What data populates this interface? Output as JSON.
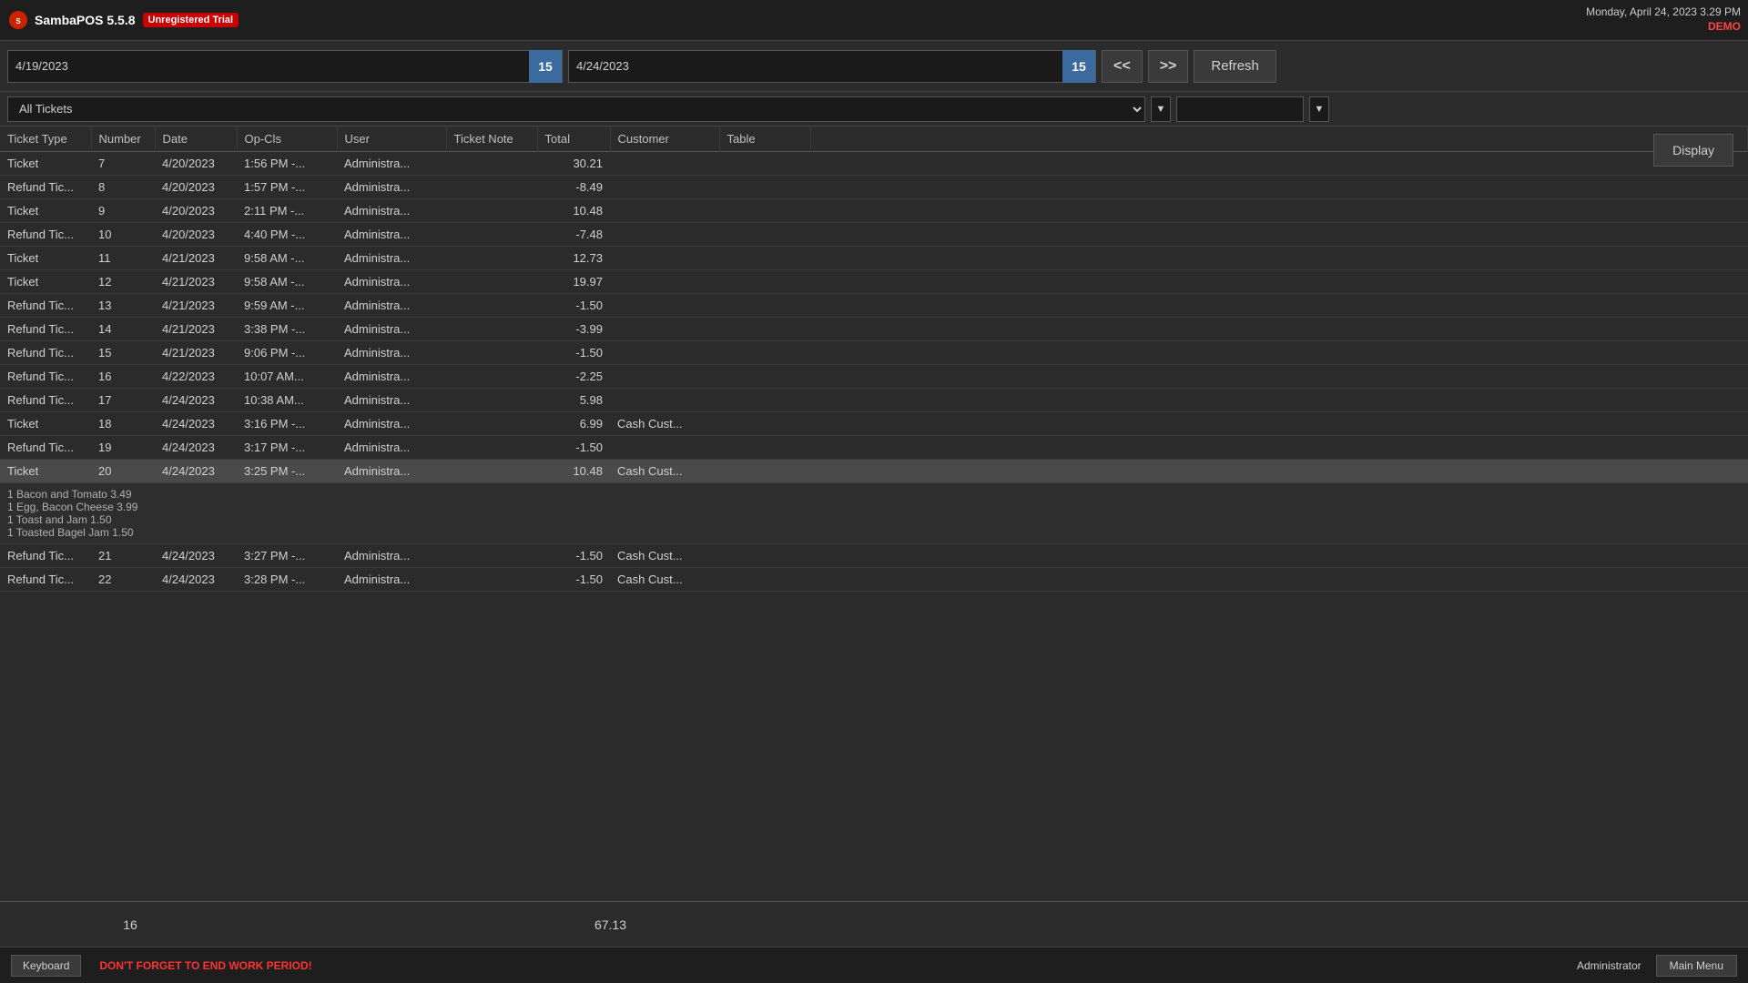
{
  "app": {
    "title": "SambaPOS 5.5.8",
    "trial_label": "Unregistered Trial",
    "datetime": "Monday, April 24, 2023 3.29 PM",
    "demo_label": "DEMO"
  },
  "date_range": {
    "from": "4/19/2023",
    "to": "4/24/2023",
    "cal_icon_from": "15",
    "cal_icon_to": "15",
    "prev_btn": "<<",
    "next_btn": ">>",
    "refresh_btn": "Refresh"
  },
  "filter": {
    "ticket_filter": "All Tickets",
    "dropdown_arrow": "▼",
    "search_dropdown_arrow": "▼"
  },
  "table": {
    "columns": [
      "Ticket Type",
      "Number",
      "Date",
      "Op-Cls",
      "User",
      "Ticket Note",
      "Total",
      "Customer",
      "Table"
    ],
    "rows": [
      {
        "type": "Ticket",
        "number": "7",
        "date": "4/20/2023",
        "op": "1:56 PM -...",
        "user": "Administra...",
        "note": "",
        "total": "30.21",
        "customer": "",
        "table": "",
        "selected": false,
        "has_detail": false
      },
      {
        "type": "Refund Tic...",
        "number": "8",
        "date": "4/20/2023",
        "op": "1:57 PM -...",
        "user": "Administra...",
        "note": "",
        "total": "-8.49",
        "customer": "",
        "table": "",
        "selected": false,
        "has_detail": false
      },
      {
        "type": "Ticket",
        "number": "9",
        "date": "4/20/2023",
        "op": "2:11 PM -...",
        "user": "Administra...",
        "note": "",
        "total": "10.48",
        "customer": "",
        "table": "",
        "selected": false,
        "has_detail": false
      },
      {
        "type": "Refund Tic...",
        "number": "10",
        "date": "4/20/2023",
        "op": "4:40 PM -...",
        "user": "Administra...",
        "note": "",
        "total": "-7.48",
        "customer": "",
        "table": "",
        "selected": false,
        "has_detail": false
      },
      {
        "type": "Ticket",
        "number": "11",
        "date": "4/21/2023",
        "op": "9:58 AM -...",
        "user": "Administra...",
        "note": "",
        "total": "12.73",
        "customer": "",
        "table": "",
        "selected": false,
        "has_detail": false
      },
      {
        "type": "Ticket",
        "number": "12",
        "date": "4/21/2023",
        "op": "9:58 AM -...",
        "user": "Administra...",
        "note": "",
        "total": "19.97",
        "customer": "",
        "table": "",
        "selected": false,
        "has_detail": false
      },
      {
        "type": "Refund Tic...",
        "number": "13",
        "date": "4/21/2023",
        "op": "9:59 AM -...",
        "user": "Administra...",
        "note": "",
        "total": "-1.50",
        "customer": "",
        "table": "",
        "selected": false,
        "has_detail": false
      },
      {
        "type": "Refund Tic...",
        "number": "14",
        "date": "4/21/2023",
        "op": "3:38 PM -...",
        "user": "Administra...",
        "note": "",
        "total": "-3.99",
        "customer": "",
        "table": "",
        "selected": false,
        "has_detail": false
      },
      {
        "type": "Refund Tic...",
        "number": "15",
        "date": "4/21/2023",
        "op": "9:06 PM -...",
        "user": "Administra...",
        "note": "",
        "total": "-1.50",
        "customer": "",
        "table": "",
        "selected": false,
        "has_detail": false
      },
      {
        "type": "Refund Tic...",
        "number": "16",
        "date": "4/22/2023",
        "op": "10:07 AM...",
        "user": "Administra...",
        "note": "",
        "total": "-2.25",
        "customer": "",
        "table": "",
        "selected": false,
        "has_detail": false
      },
      {
        "type": "Refund Tic...",
        "number": "17",
        "date": "4/24/2023",
        "op": "10:38 AM...",
        "user": "Administra...",
        "note": "",
        "total": "5.98",
        "customer": "",
        "table": "",
        "selected": false,
        "has_detail": false
      },
      {
        "type": "Ticket",
        "number": "18",
        "date": "4/24/2023",
        "op": "3:16 PM -...",
        "user": "Administra...",
        "note": "",
        "total": "6.99",
        "customer": "Cash Cust...",
        "table": "",
        "selected": false,
        "has_detail": false
      },
      {
        "type": "Refund Tic...",
        "number": "19",
        "date": "4/24/2023",
        "op": "3:17 PM -...",
        "user": "Administra...",
        "note": "",
        "total": "-1.50",
        "customer": "",
        "table": "",
        "selected": false,
        "has_detail": false
      },
      {
        "type": "Ticket",
        "number": "20",
        "date": "4/24/2023",
        "op": "3:25 PM -...",
        "user": "Administra...",
        "note": "",
        "total": "10.48",
        "customer": "Cash Cust...",
        "table": "",
        "selected": true,
        "has_detail": true
      },
      {
        "type": "Refund Tic...",
        "number": "21",
        "date": "4/24/2023",
        "op": "3:27 PM -...",
        "user": "Administra...",
        "note": "",
        "total": "-1.50",
        "customer": "Cash Cust...",
        "table": "",
        "selected": false,
        "has_detail": false
      },
      {
        "type": "Refund Tic...",
        "number": "22",
        "date": "4/24/2023",
        "op": "3:28 PM -...",
        "user": "Administra...",
        "note": "",
        "total": "-1.50",
        "customer": "Cash Cust...",
        "table": "",
        "selected": false,
        "has_detail": false
      }
    ],
    "detail_items": [
      "1 Bacon and Tomato 3.49",
      "1 Egg, Bacon Cheese 3.99",
      "1 Toast and Jam 1.50",
      "1 Toasted Bagel Jam 1.50"
    ]
  },
  "totals": {
    "count": "16",
    "amount": "67.13"
  },
  "display_btn": "Display",
  "footer": {
    "keyboard_btn": "Keyboard",
    "warning": "DON'T FORGET TO END WORK PERIOD!",
    "admin_label": "Administrator",
    "main_menu_btn": "Main Menu"
  }
}
